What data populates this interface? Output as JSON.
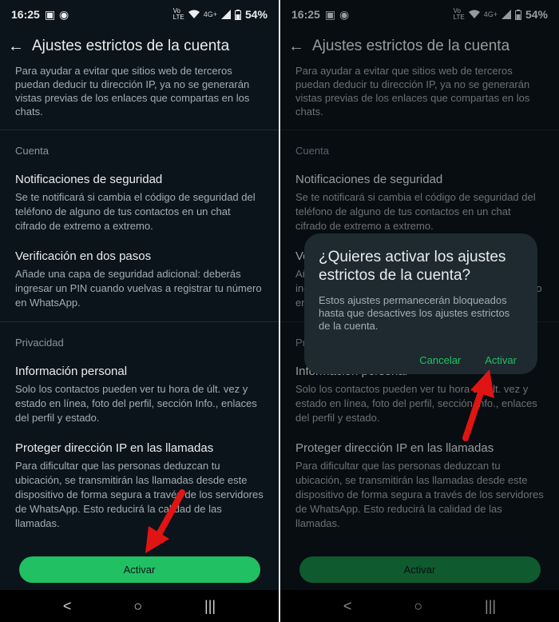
{
  "status": {
    "time": "16:25",
    "network": "4G+",
    "battery": "54%"
  },
  "header": {
    "title": "Ajustes estrictos de la cuenta"
  },
  "intro_text": "Para ayudar a evitar que sitios web de terceros puedan deducir tu dirección IP, ya no se generarán vistas previas de los enlaces que compartas en los chats.",
  "sections": [
    {
      "label": "Cuenta",
      "items": [
        {
          "title": "Notificaciones de seguridad",
          "description": "Se te notificará si cambia el código de seguridad del teléfono de alguno de tus contactos en un chat cifrado de extremo a extremo."
        },
        {
          "title": "Verificación en dos pasos",
          "description": "Añade una capa de seguridad adicional: deberás ingresar un PIN cuando vuelvas a registrar tu número en WhatsApp."
        }
      ]
    },
    {
      "label": "Privacidad",
      "items": [
        {
          "title": "Información personal",
          "description": "Solo los contactos pueden ver tu hora de últ. vez y estado en línea, foto del perfil, sección Info., enlaces del perfil y estado."
        },
        {
          "title": "Proteger dirección IP en las llamadas",
          "description": "Para dificultar que las personas deduzcan tu ubicación, se transmitirán las llamadas desde este dispositivo de forma segura a través de los servidores de WhatsApp. Esto reducirá la calidad de las llamadas."
        }
      ]
    }
  ],
  "primary_button": "Activar",
  "dialog": {
    "title": "¿Quieres activar los ajustes estrictos de la cuenta?",
    "body": "Estos ajustes permanecerán bloqueados hasta que desactives los ajustes estrictos de la cuenta.",
    "cancel": "Cancelar",
    "confirm": "Activar"
  },
  "nav": {
    "back": "<",
    "home": "○",
    "recents": "|||"
  },
  "colors": {
    "background": "#0b141a",
    "accent": "#21c063",
    "dialog_bg": "#1e2a30",
    "annotation_arrow": "#e11414"
  },
  "icons": [
    "back-arrow-icon",
    "wifi-icon",
    "signal-icon",
    "battery-icon",
    "nav-back-icon",
    "nav-home-icon",
    "nav-recents-icon"
  ]
}
